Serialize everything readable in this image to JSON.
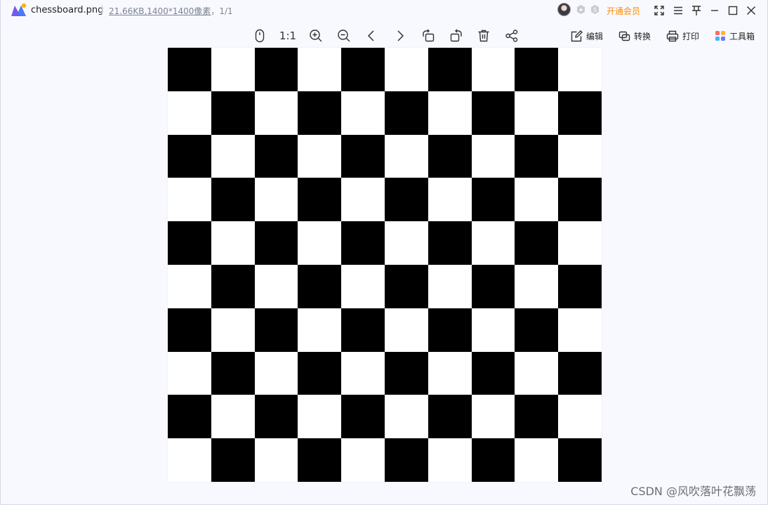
{
  "titlebar": {
    "file_name": "chessboard.png",
    "file_size": "21.66KB",
    "dimensions": ",1400*1400像素",
    "page_index": "，1/1",
    "vip_label": "开通会员"
  },
  "toolbar": {
    "ratio_label": "1:1",
    "edit_label": "编辑",
    "convert_label": "转换",
    "print_label": "打印",
    "toolbox_label": "工具箱"
  },
  "image": {
    "rows": 10,
    "cols": 10,
    "top_left_color": "#000000",
    "alt_color": "#ffffff"
  },
  "watermark": "CSDN @风吹落叶花飘荡",
  "colors": {
    "vip": "#ff8a00",
    "background": "#f8f9fe",
    "icon": "#333333"
  }
}
